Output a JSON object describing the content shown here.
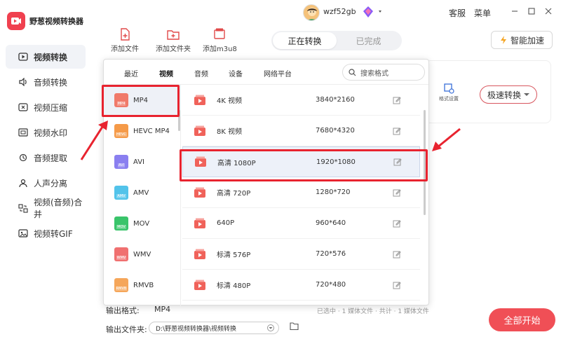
{
  "app": {
    "title": "野葱视频转换器",
    "brand_color": "#f0404f"
  },
  "sidebar": {
    "items": [
      {
        "label": "视频转换",
        "icon": "video-convert-icon",
        "active": true
      },
      {
        "label": "音频转换",
        "icon": "audio-convert-icon"
      },
      {
        "label": "视频压缩",
        "icon": "video-compress-icon"
      },
      {
        "label": "视频水印",
        "icon": "watermark-icon"
      },
      {
        "label": "音频提取",
        "icon": "audio-extract-icon"
      },
      {
        "label": "人声分离",
        "icon": "voice-separate-icon"
      },
      {
        "label": "视频(音频)合并",
        "icon": "merge-icon"
      },
      {
        "label": "视频转GIF",
        "icon": "gif-icon"
      }
    ]
  },
  "topbar": {
    "username": "wzf52gb",
    "service": "客服",
    "menu": "菜单"
  },
  "toolbar": {
    "add_file": "添加文件",
    "add_folder": "添加文件夹",
    "add_m3u8": "添加m3u8"
  },
  "segment": {
    "converting": "正在转换",
    "done": "已完成"
  },
  "accelerate": "智能加速",
  "card": {
    "format_settings": "格式设置",
    "speed_convert": "极速转换"
  },
  "bottom": {
    "output_format_label": "输出格式:",
    "output_format_value": "MP4",
    "output_folder_label": "输出文件夹:",
    "output_folder_path": "D:\\野葱视频转换器\\视频转换",
    "hint_text": "已选中 · 1 媒体文件 · 共计 · 1 媒体文件",
    "start_all": "全部开始"
  },
  "popup": {
    "tabs": [
      "最近",
      "视频",
      "音频",
      "设备",
      "网络平台"
    ],
    "active_tab": "视频",
    "search_placeholder": "搜索格式",
    "formats": [
      {
        "label": "MP4",
        "badge": "MP4",
        "color": "#f07a6a",
        "selected": true
      },
      {
        "label": "HEVC MP4",
        "badge": "HEVC",
        "color": "#f59a48"
      },
      {
        "label": "AVI",
        "badge": "AVI",
        "color": "#8a7ff0"
      },
      {
        "label": "AMV",
        "badge": "AMV",
        "color": "#52c3ea"
      },
      {
        "label": "MOV",
        "badge": "MOV",
        "color": "#39c46a"
      },
      {
        "label": "WMV",
        "badge": "WMV",
        "color": "#f07070"
      },
      {
        "label": "RMVB",
        "badge": "RMVB",
        "color": "#f5a65a"
      }
    ],
    "presets": [
      {
        "name": "4K 视频",
        "res": "3840*2160"
      },
      {
        "name": "8K 视频",
        "res": "7680*4320"
      },
      {
        "name": "高清 1080P",
        "res": "1920*1080",
        "selected": true
      },
      {
        "name": "高清 720P",
        "res": "1280*720"
      },
      {
        "name": "640P",
        "res": "960*640"
      },
      {
        "name": "标清 576P",
        "res": "720*576"
      },
      {
        "name": "标清 480P",
        "res": "720*480"
      }
    ]
  },
  "annotation_color": "#e8232f"
}
